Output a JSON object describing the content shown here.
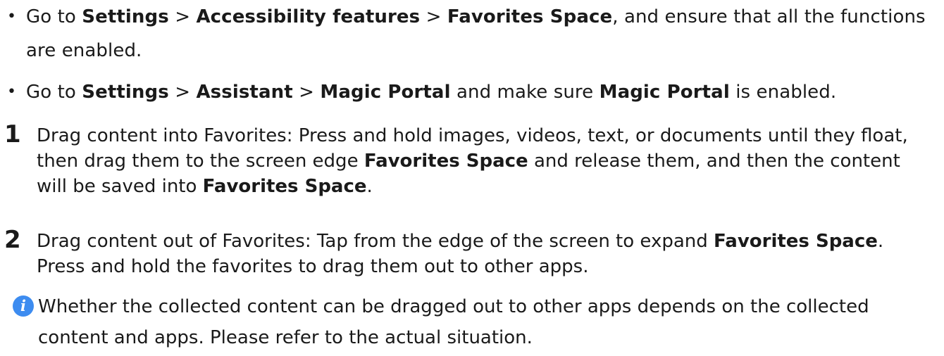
{
  "bullets": [
    {
      "symbol": "•",
      "parts": [
        {
          "t": "Go to ",
          "b": false
        },
        {
          "t": "Settings",
          "b": true
        },
        {
          "t": " > ",
          "b": false
        },
        {
          "t": "Accessibility features",
          "b": true
        },
        {
          "t": " > ",
          "b": false
        },
        {
          "t": "Favorites Space",
          "b": true
        },
        {
          "t": ", and ensure that all the functions are enabled.",
          "b": false
        }
      ]
    },
    {
      "symbol": "•",
      "parts": [
        {
          "t": "Go to ",
          "b": false
        },
        {
          "t": "Settings",
          "b": true
        },
        {
          "t": " > ",
          "b": false
        },
        {
          "t": "Assistant",
          "b": true
        },
        {
          "t": " > ",
          "b": false
        },
        {
          "t": "Magic Portal",
          "b": true
        },
        {
          "t": " and make sure ",
          "b": false
        },
        {
          "t": "Magic Portal",
          "b": true
        },
        {
          "t": " is enabled.",
          "b": false
        }
      ]
    }
  ],
  "steps": [
    {
      "number": "1",
      "parts": [
        {
          "t": "Drag content into Favorites: Press and hold images, videos, text, or documents until they float, then drag them to the screen edge ",
          "b": false
        },
        {
          "t": "Favorites Space",
          "b": true
        },
        {
          "t": " and release them, and then the content will be saved into ",
          "b": false
        },
        {
          "t": "Favorites Space",
          "b": true
        },
        {
          "t": ".",
          "b": false
        }
      ]
    },
    {
      "number": "2",
      "parts": [
        {
          "t": "Drag content out of Favorites: Tap from the edge of the screen to expand ",
          "b": false
        },
        {
          "t": "Favorites Space",
          "b": true
        },
        {
          "t": ". Press and hold the favorites to drag them out to other apps.",
          "b": false
        }
      ]
    }
  ],
  "note": {
    "icon": "info-icon",
    "icon_glyph": "i",
    "icon_color": "#3d8cf0",
    "text": "Whether the collected content can be dragged out to other apps depends on the collected content and apps. Please refer to the actual situation."
  }
}
